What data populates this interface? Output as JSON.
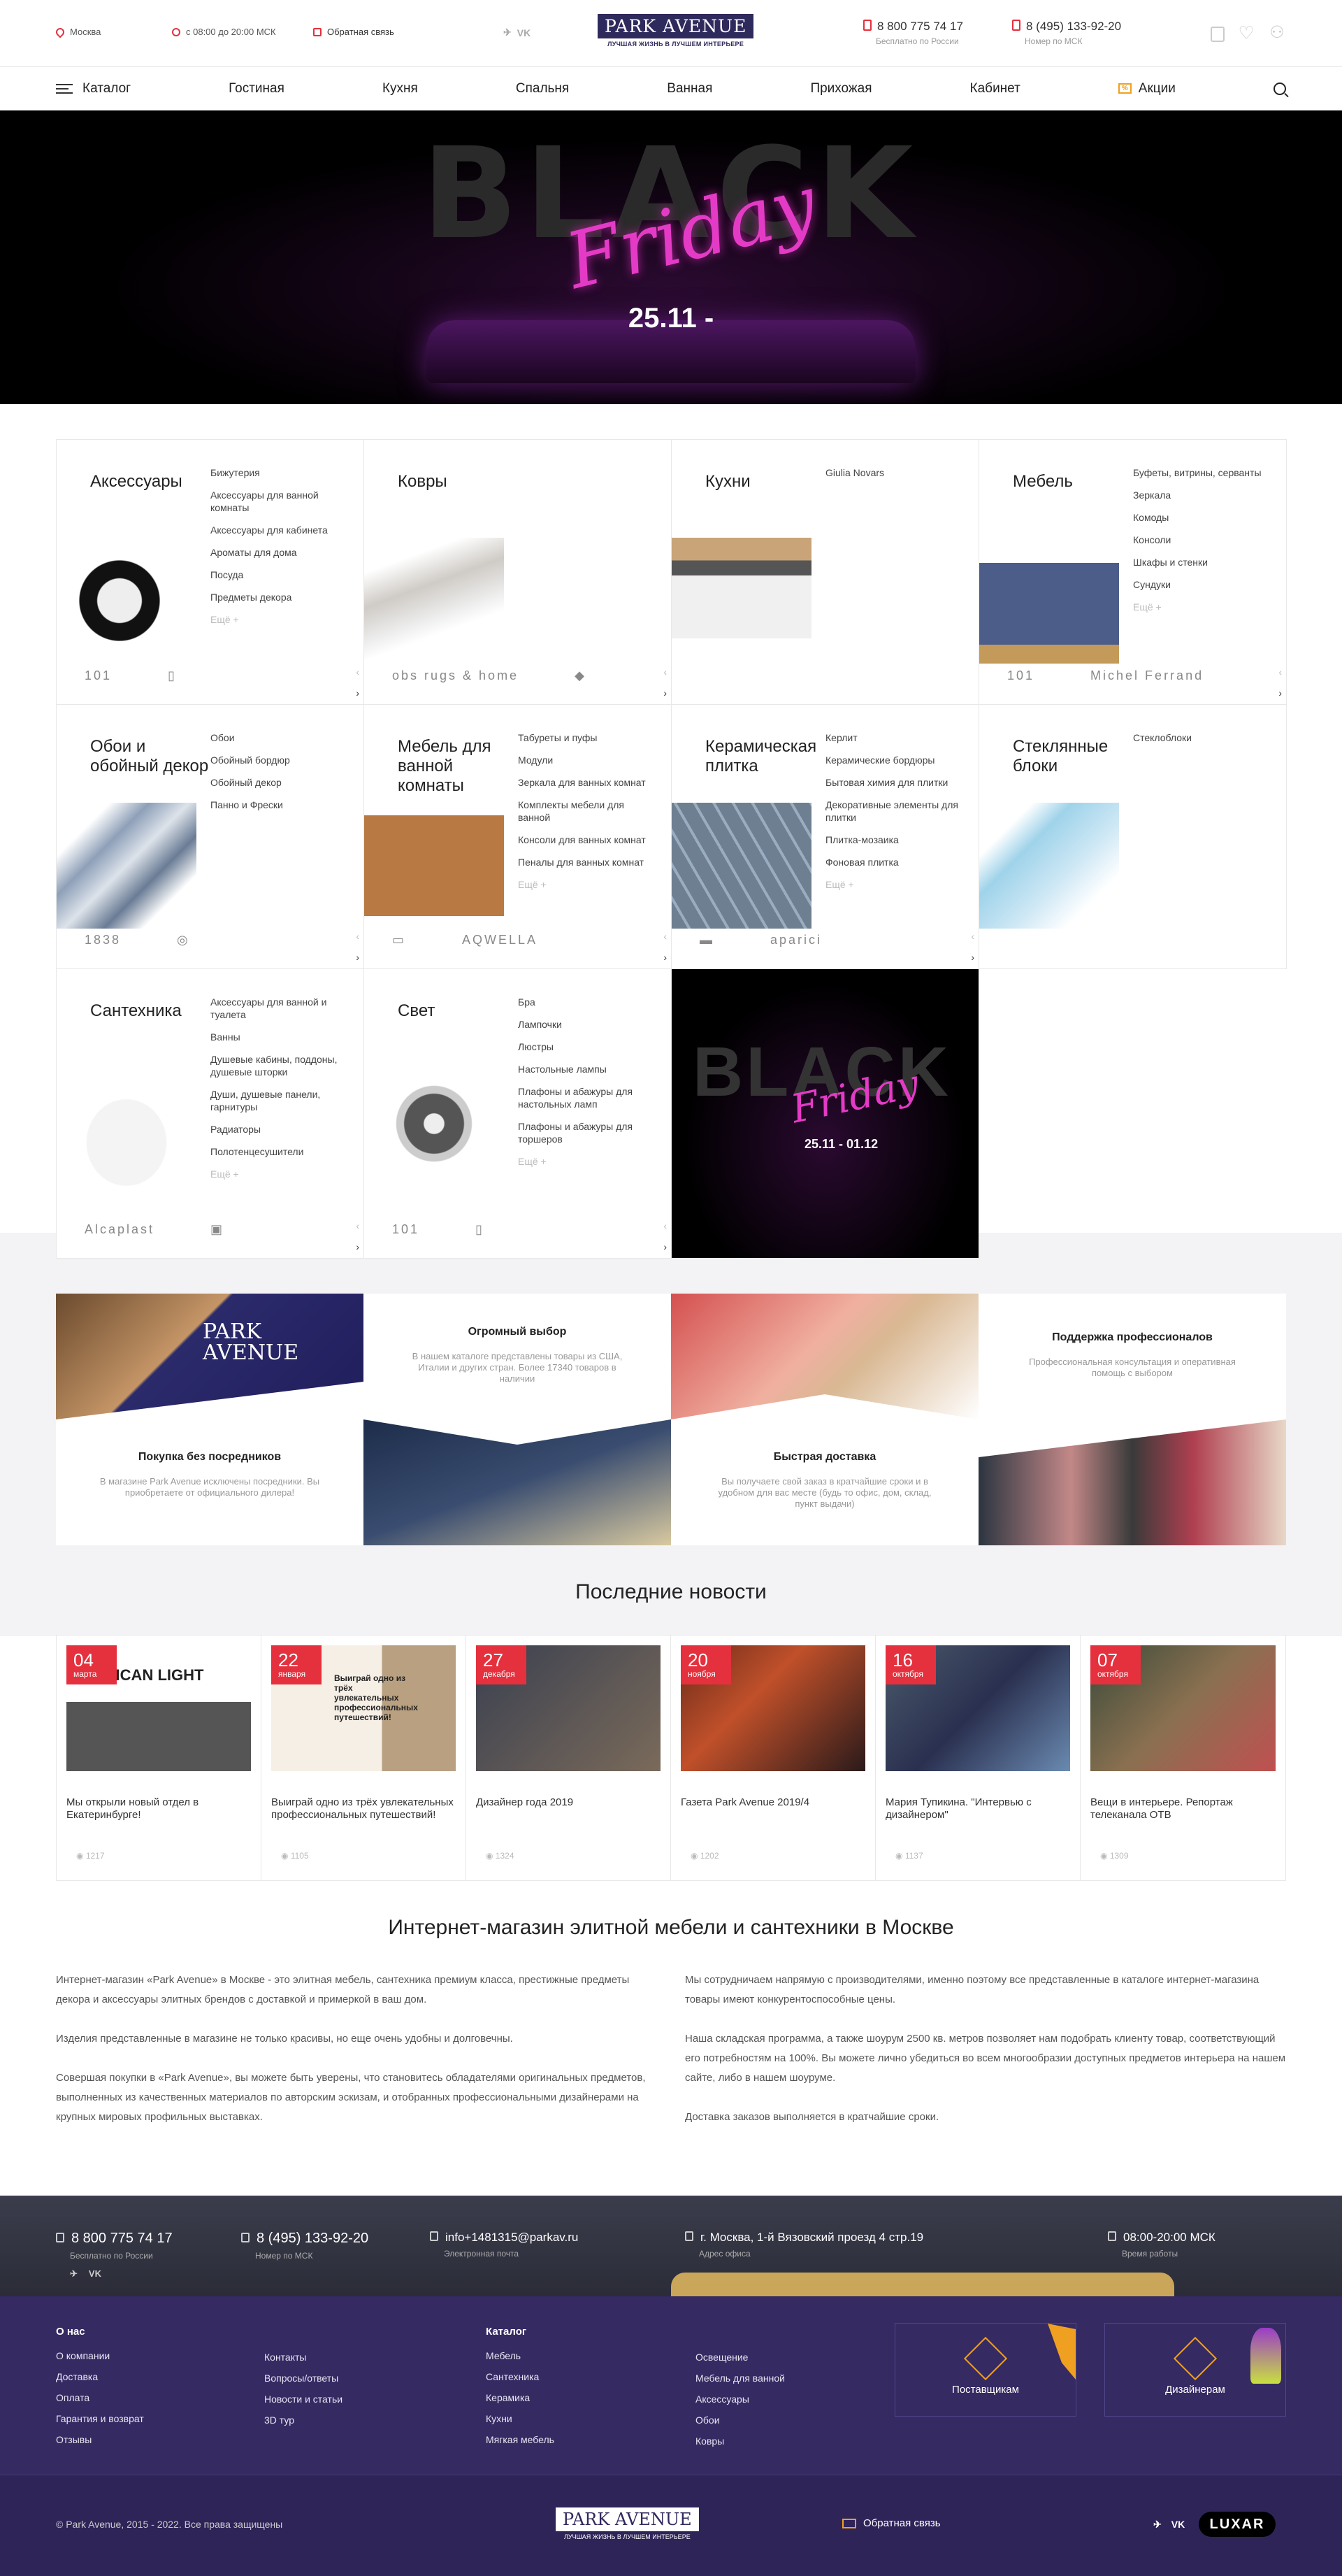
{
  "topbar": {
    "city": "Москва",
    "hours": "с 08:00 до 20:00 МСК",
    "feedback": "Обратная связь",
    "social": [
      "✈",
      "VK"
    ],
    "logo": "PARK AVENUE",
    "logo_sub": "ЛУЧШАЯ ЖИЗНЬ В ЛУЧШЕМ ИНТЕРЬЕРЕ",
    "phone1": "8 800 775 74 17",
    "phone1_cap": "Бесплатно по России",
    "phone2": "8 (495) 133-92-20",
    "phone2_cap": "Номер по МСК"
  },
  "nav": {
    "catalog": "Каталог",
    "items": [
      "Гостиная",
      "Кухня",
      "Спальня",
      "Ванная",
      "Прихожая",
      "Кабинет"
    ],
    "promo_tag": "%",
    "promo": "Акции"
  },
  "hero": {
    "big": "BLACK",
    "script": "Friday",
    "date": "25.11 -"
  },
  "categories": [
    {
      "title": "Аксессуары",
      "subs": [
        "Бижутерия",
        "Аксессуары для ванной комнаты",
        "Аксессуары для кабинета",
        "Ароматы для дома",
        "Посуда",
        "Предметы декора",
        "Ещё +"
      ],
      "brands": [
        "101",
        "▯"
      ]
    },
    {
      "title": "Ковры",
      "subs": [],
      "brands": [
        "obs rugs & home",
        "◆"
      ]
    },
    {
      "title": "Кухни",
      "subs": [
        "Giulia Novars"
      ],
      "brands": []
    },
    {
      "title": "Мебель",
      "subs": [
        "Буфеты, витрины, серванты",
        "Зеркала",
        "Комоды",
        "Консоли",
        "Шкафы и стенки",
        "Сундуки",
        "Ещё +"
      ],
      "brands": [
        "101",
        "Michel Ferrand"
      ]
    },
    {
      "title": "Обои и обойный декор",
      "subs": [
        "Обои",
        "Обойный бордюр",
        "Обойный декор",
        "Панно и Фрески"
      ],
      "brands": [
        "1838",
        "◎"
      ]
    },
    {
      "title": "Мебель для ванной комнаты",
      "subs": [
        "Табуреты и пуфы",
        "Модули",
        "Зеркала для ванных комнат",
        "Комплекты мебели для ванной",
        "Консоли для ванных комнат",
        "Пеналы для ванных комнат",
        "Ещё +"
      ],
      "brands": [
        "▭",
        "AQWELLA"
      ]
    },
    {
      "title": "Керамическая плитка",
      "subs": [
        "Керлит",
        "Керамические бордюры",
        "Бытовая химия для плитки",
        "Декоративные элементы для плитки",
        "Плитка-мозаика",
        "Фоновая плитка",
        "Ещё +"
      ],
      "brands": [
        "▬",
        "aparici"
      ]
    },
    {
      "title": "Стеклянные блоки",
      "subs": [
        "Стеклоблоки"
      ],
      "brands": []
    },
    {
      "title": "Сантехника",
      "subs": [
        "Аксессуары для ванной и туалета",
        "Ванны",
        "Душевые кабины, поддоны, душевые шторки",
        "Души, душевые панели, гарнитуры",
        "Радиаторы",
        "Полотенцесушители",
        "Ещё +"
      ],
      "brands": [
        "Alcaplast",
        "▣"
      ]
    },
    {
      "title": "Свет",
      "subs": [
        "Бра",
        "Лампочки",
        "Люстры",
        "Настольные лампы",
        "Плафоны и абажуры для настольных ламп",
        "Плафоны и абажуры для торшеров",
        "Ещё +"
      ],
      "brands": [
        "101",
        "▯"
      ]
    }
  ],
  "promo_cell": {
    "big": "BLACK",
    "script": "Friday",
    "date": "25.11 - 01.12"
  },
  "advantages": [
    {
      "title": "Покупка без посредников",
      "text": "В магазине Park Avenue исключены посредники. Вы приобретаете от официального дилера!",
      "banner": "PARK AVENUE"
    },
    {
      "title": "Огромный выбор",
      "text": "В нашем каталоге представлены товары из США, Италии и других стран. Более 17340 товаров в наличии"
    },
    {
      "title": "Быстрая доставка",
      "text": "Вы получаете свой заказ в кратчайшие сроки и в удобном для вас месте (будь то офис, дом, склад, пункт выдачи)"
    },
    {
      "title": "Поддержка профессионалов",
      "text": "Профессиональная консультация и оперативная помощь с выбором"
    }
  ],
  "news_title": "Последние новости",
  "news": [
    {
      "day": "04",
      "month": "марта",
      "title": "Мы открыли новый отдел в Екатеринбурге!",
      "views": "1217",
      "pic": "ERICAN LIGHT"
    },
    {
      "day": "22",
      "month": "января",
      "title": "Выиграй одно из трёх увлекательных профессиональных путешествий!",
      "views": "1105",
      "pic": "Выиграй одно из трёх увлекательных профессиональных путешествий!"
    },
    {
      "day": "27",
      "month": "декабря",
      "title": "Дизайнер года 2019",
      "views": "1324",
      "pic": ""
    },
    {
      "day": "20",
      "month": "ноября",
      "title": "Газета Park Avenue 2019/4",
      "views": "1202",
      "pic": ""
    },
    {
      "day": "16",
      "month": "октября",
      "title": "Мария Тупикина. \"Интервью с дизайнером\"",
      "views": "1137",
      "pic": ""
    },
    {
      "day": "07",
      "month": "октября",
      "title": "Вещи в интерьере. Репортаж телеканала ОТВ",
      "views": "1309",
      "pic": ""
    }
  ],
  "about": {
    "title": "Интернет-магазин элитной мебели и сантехники в Москве",
    "left": [
      "Интернет-магазин «Park Avenue» в Москве - это элитная мебель, сантехника премиум класса, престижные предметы декора и аксессуары элитных брендов с доставкой и примеркой в ваш дом.",
      "Изделия представленные в магазине не только красивы, но еще очень удобны и долговечны.",
      "Совершая покупки в «Park Avenue», вы можете быть уверены, что становитесь обладателями оригинальных предметов, выполненных из качественных материалов по авторским эскизам, и отобранных профессиональными дизайнерами на крупных мировых профильных выставках."
    ],
    "right": [
      "Мы сотрудничаем напрямую с производителями, именно поэтому все представленные в каталоге интернет-магазина товары имеют конкурентоспособные цены.",
      "Наша складская программа, а также шоурум 2500 кв. метров позволяет нам подобрать клиенту товар, соответствующий его потребностям на 100%. Вы можете лично убедиться во всем многообразии доступных предметов интерьера на нашем сайте, либо в нашем шоуруме.",
      "Доставка заказов выполняется в кратчайшие сроки."
    ]
  },
  "footer": {
    "contacts": [
      {
        "v": "8 800 775 74 17",
        "c": "Бесплатно по России"
      },
      {
        "v": "8 (495) 133-92-20",
        "c": "Номер по МСК"
      },
      {
        "v": "info+1481315@parkav.ru",
        "c": "Электронная почта"
      },
      {
        "v": "г. Москва, 1-й Вязовский проезд 4 стр.19",
        "c": "Адрес офиса"
      },
      {
        "v": "08:00-20:00 МСК",
        "c": "Время работы"
      }
    ],
    "social": [
      "✈",
      "VK"
    ],
    "about_title": "О нас",
    "about_links": [
      "О компании",
      "Доставка",
      "Оплата",
      "Гарантия и возврат",
      "Отзывы"
    ],
    "about_links2": [
      "Контакты",
      "Вопросы/ответы",
      "Новости и статьи",
      "3D тур"
    ],
    "catalog_title": "Каталог",
    "catalog_links": [
      "Мебель",
      "Сантехника",
      "Керамика",
      "Кухни",
      "Мягкая мебель"
    ],
    "catalog_links2": [
      "Освещение",
      "Мебель для ванной",
      "Аксессуары",
      "Обои",
      "Ковры"
    ],
    "box1": "Поставщикам",
    "box2": "Дизайнерам",
    "copyright": "© Park Avenue, 2015 - 2022. Все права защищены",
    "logo": "PARK AVENUE",
    "logo_sub": "ЛУЧШАЯ ЖИЗНЬ В ЛУЧШЕМ ИНТЕРЬЕРЕ",
    "feedback": "Обратная связь",
    "luxar": "LUXAR"
  }
}
